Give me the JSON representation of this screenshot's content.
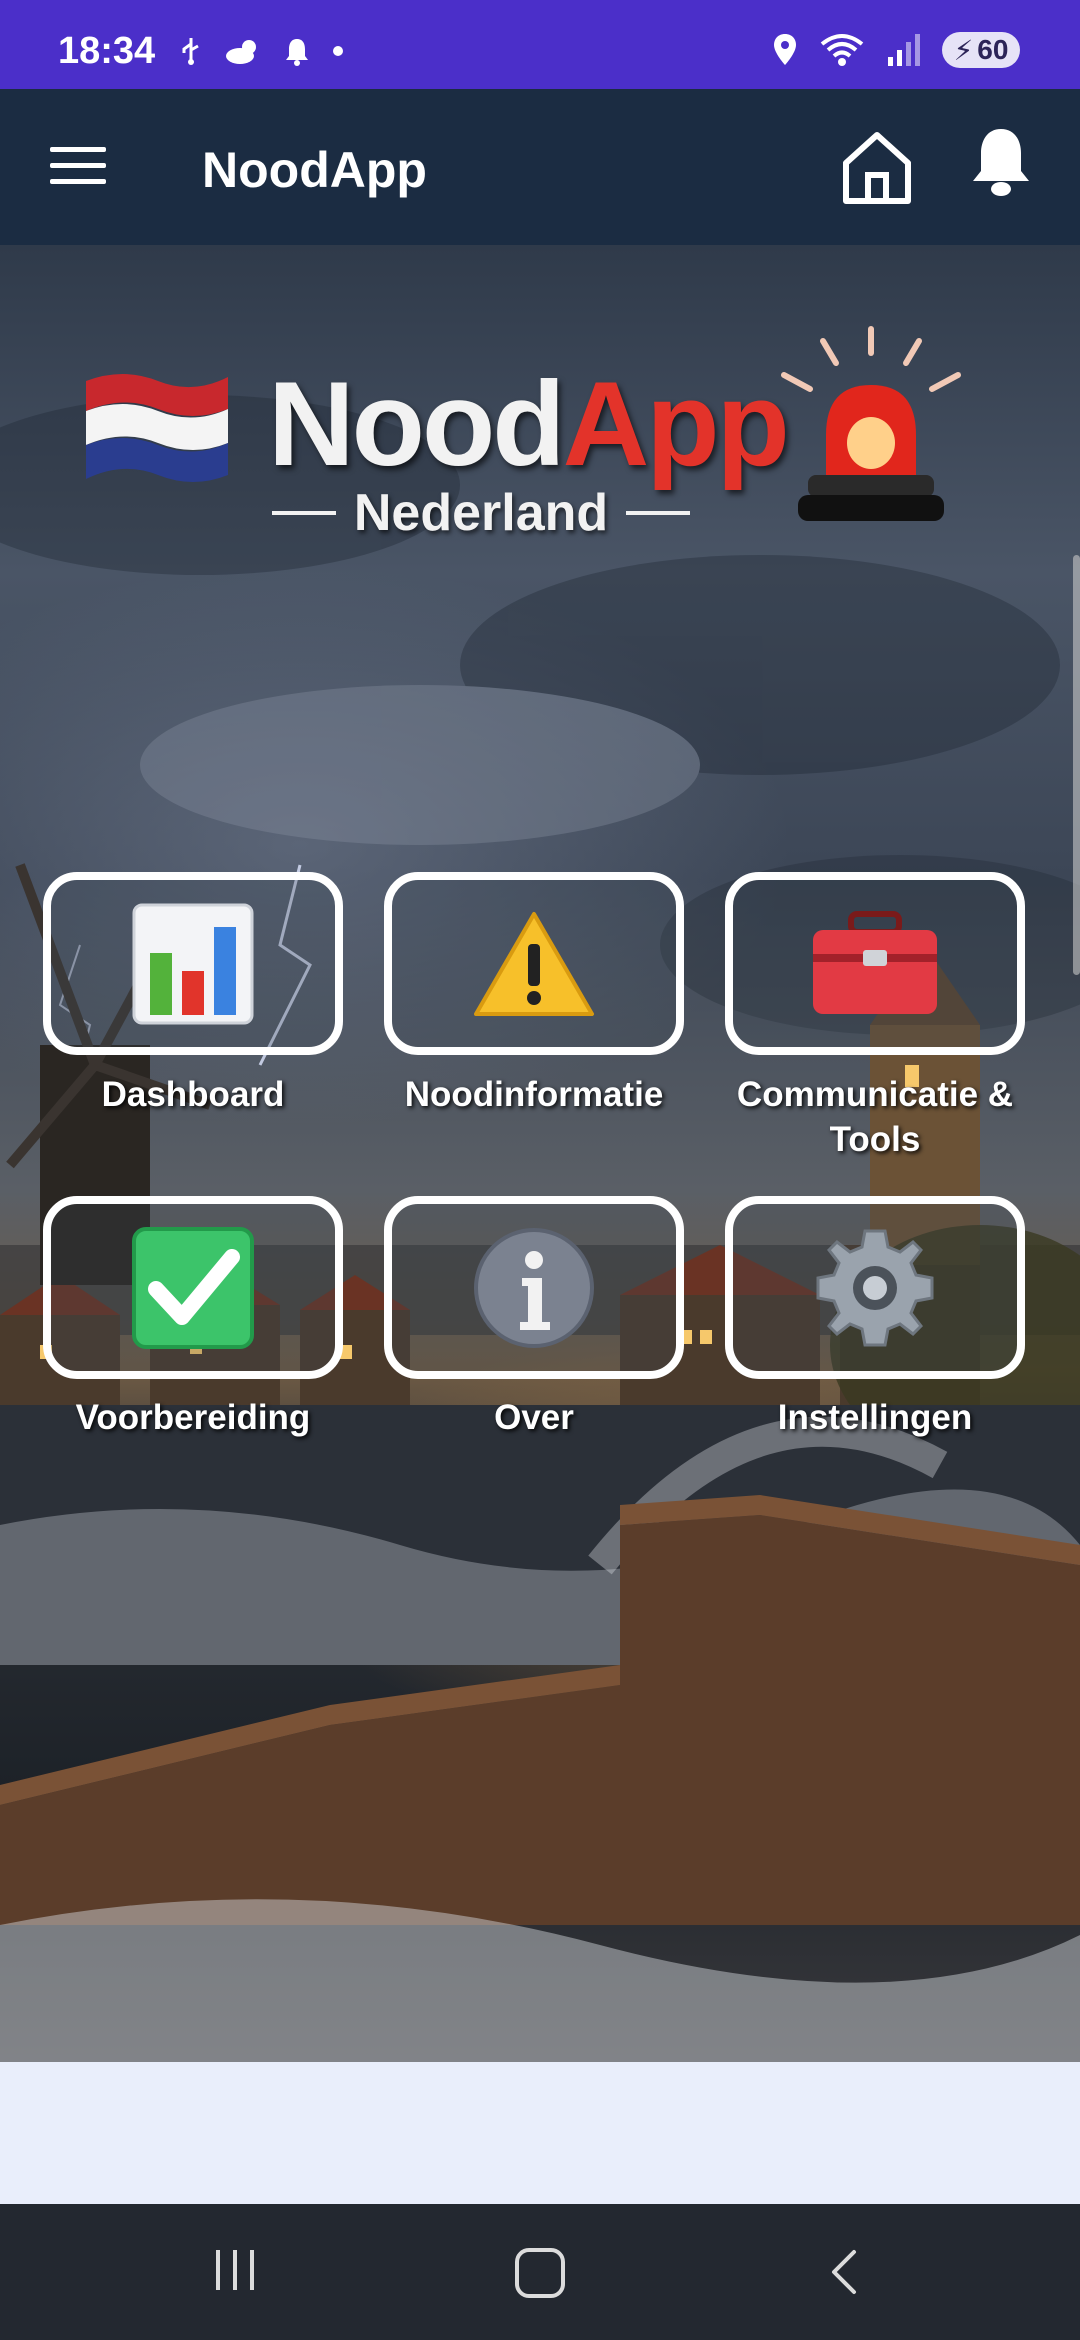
{
  "status_bar": {
    "time": "18:34",
    "battery": "60",
    "icons_left": [
      "usb-icon",
      "weather-icon",
      "notification-icon",
      "dot-icon"
    ],
    "icons_right": [
      "location-icon",
      "wifi-icon",
      "signal-icon",
      "battery-icon"
    ]
  },
  "app_bar": {
    "title": "NoodApp",
    "icons": [
      "menu-icon",
      "home-icon",
      "bell-icon"
    ]
  },
  "hero": {
    "logo_text_a": "Nood",
    "logo_text_b": "App",
    "logo_sub": "Nederland"
  },
  "tiles": [
    {
      "label": "Dashboard",
      "icon": "bar-chart-icon"
    },
    {
      "label": "Noodinformatie",
      "icon": "warning-icon"
    },
    {
      "label": "Communicatie & Tools",
      "icon": "toolbox-icon"
    },
    {
      "label": "Voorbereiding",
      "icon": "checkmark-icon"
    },
    {
      "label": "Over",
      "icon": "info-icon"
    },
    {
      "label": "Instellingen",
      "icon": "gear-icon"
    }
  ],
  "colors": {
    "status_bar": "#4b2fc9",
    "app_bar": "#1b2c42",
    "logo_accent": "#e3332a",
    "nav_bar": "#232830"
  }
}
